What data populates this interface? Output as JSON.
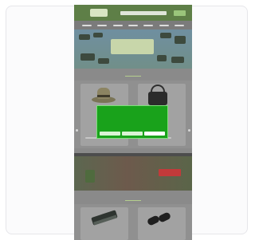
{
  "site": {
    "logo_text": "",
    "hero_title": "",
    "section1_label": "",
    "section2_label": "",
    "banner_title": "",
    "banner_badge": ""
  },
  "consent": {
    "title": "",
    "body": "",
    "btn_settings": "",
    "btn_reject": "",
    "btn_accept": ""
  },
  "colors": {
    "consent_bg": "#19a21b",
    "topbar": "#5e7f47"
  }
}
